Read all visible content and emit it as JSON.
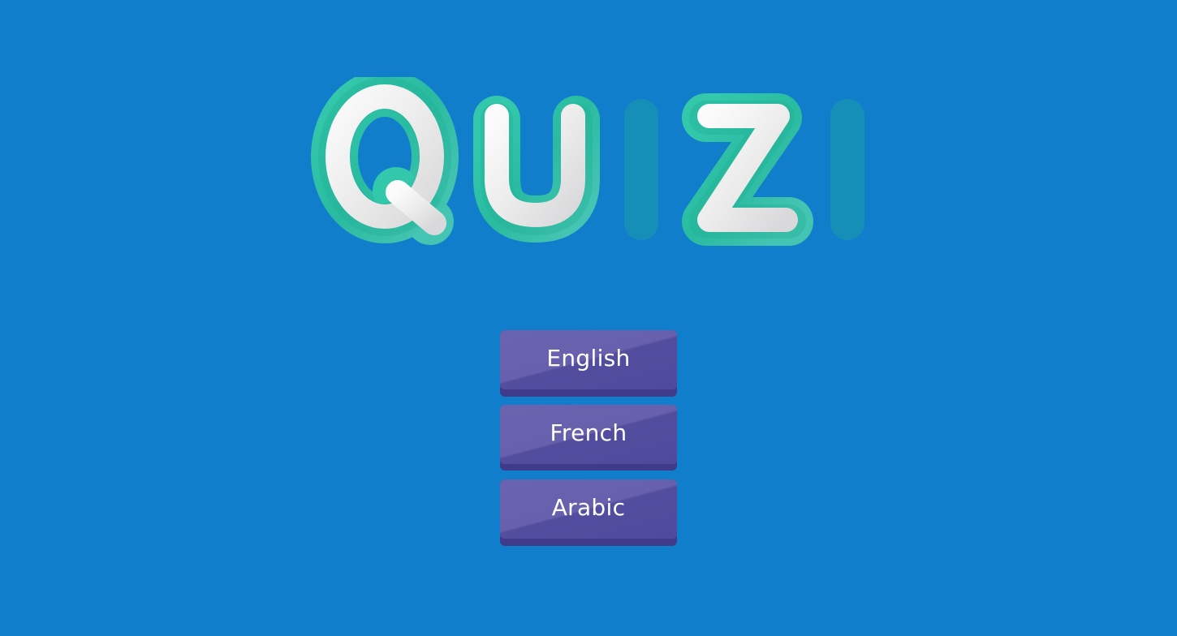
{
  "app": {
    "logo_text": "QUIZI"
  },
  "colors": {
    "background": "#117ecb",
    "logo_outline": "#2fc1a7",
    "logo_letter": "#efeff0",
    "button_face": "#625cab",
    "button_shadow": "#3f3a8a",
    "button_text": "#ffffff"
  },
  "menu": {
    "buttons": [
      {
        "label": "English"
      },
      {
        "label": "French"
      },
      {
        "label": "Arabic"
      }
    ]
  }
}
